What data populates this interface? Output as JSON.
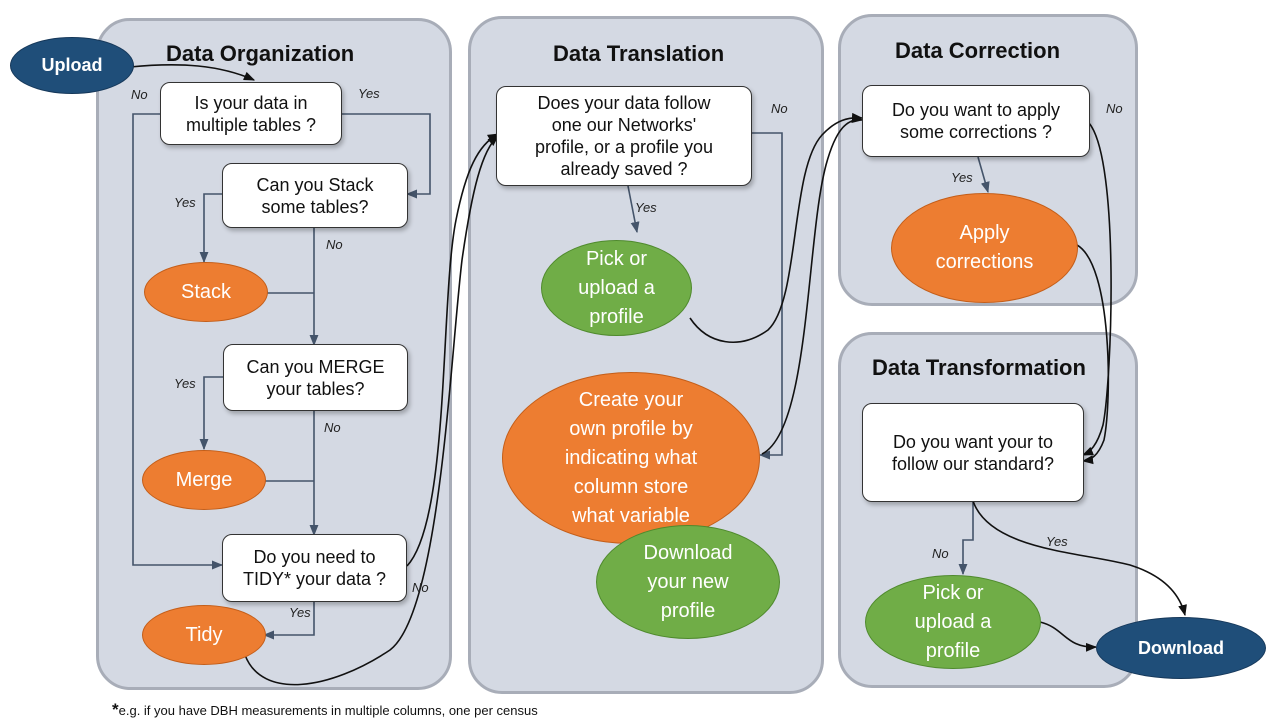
{
  "panels": {
    "organization": {
      "title": "Data Organization"
    },
    "translation": {
      "title": "Data Translation"
    },
    "correction": {
      "title": "Data Correction"
    },
    "transformation": {
      "title": "Data Transformation"
    }
  },
  "nodes": {
    "upload": "Upload",
    "q_multiple_tables": "Is your data in\nmultiple tables ?",
    "q_stack": "Can you Stack\nsome tables?",
    "stack": "Stack",
    "q_merge": "Can you MERGE\nyour tables?",
    "merge": "Merge",
    "q_tidy": "Do you need to\nTIDY* your data ?",
    "tidy": "Tidy",
    "q_profile": "Does your data follow\none our Networks'\nprofile, or a profile you\nalready saved ?",
    "pick_profile_translation": "Pick or\nupload a\nprofile",
    "create_profile": "Create your\nown profile by\nindicating what\ncolumn store\nwhat variable",
    "download_profile": "Download\nyour new\nprofile",
    "q_corrections": "Do you want to apply\nsome corrections ?",
    "apply_corrections": "Apply\ncorrections",
    "q_standard": "Do you want your to\nfollow our standard?",
    "pick_profile_transformation": "Pick or\nupload a\nprofile",
    "download": "Download"
  },
  "edge_labels": {
    "yes": "Yes",
    "no": "No"
  },
  "footnote": {
    "marker": "*",
    "text": "e.g. if you have DBH measurements in multiple columns, one per census"
  },
  "colors": {
    "panel_fill": "#d4d9e3",
    "panel_border": "#a8adb8",
    "action_orange": "#ed7d31",
    "profile_green": "#70ad47",
    "terminal_navy": "#1f4e79",
    "connector": "#44546a"
  }
}
